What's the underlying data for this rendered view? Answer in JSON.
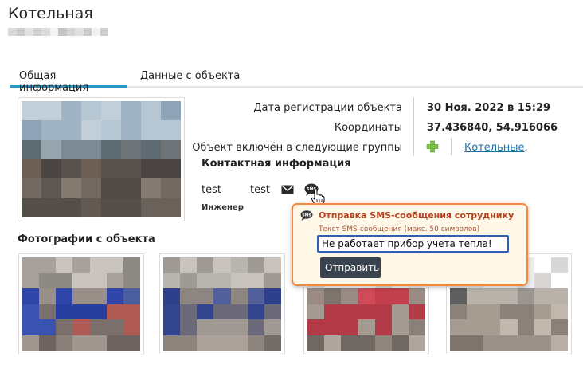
{
  "page": {
    "title": "Котельная"
  },
  "tabs": [
    {
      "label": "Общая информация",
      "active": true
    },
    {
      "label": "Данные с объекта",
      "active": false
    }
  ],
  "info": {
    "rows": [
      {
        "label": "Дата регистрации объекта",
        "value": "30 Ноя. 2022 в 15:29"
      },
      {
        "label": "Координаты",
        "value": "37.436840, 54.916066"
      },
      {
        "label": "Объект включён в следующие группы",
        "value": "Котельные",
        "value_suffix": "."
      }
    ]
  },
  "contacts": {
    "heading": "Контактная информация",
    "first_name": "test",
    "last_name": "test",
    "role": "Инженер"
  },
  "photos": {
    "heading": "Фотографии с объекта"
  },
  "sms_popup": {
    "icon_text": "SMS",
    "title": "Отправка SMS-сообщения сотруднику",
    "hint": "Текст SMS-сообщения (макс. 50 символов)",
    "input_value": "Не работает прибор учета тепла!",
    "send_label": "Отправить"
  },
  "colors": {
    "tab_accent": "#2a97c9",
    "popup_border": "#ef8a3e",
    "popup_bg": "#fff7e7",
    "popup_title": "#b4431d",
    "link": "#1a6fa0",
    "add_icon": "#7ac142",
    "button_bg": "#3a4350"
  }
}
